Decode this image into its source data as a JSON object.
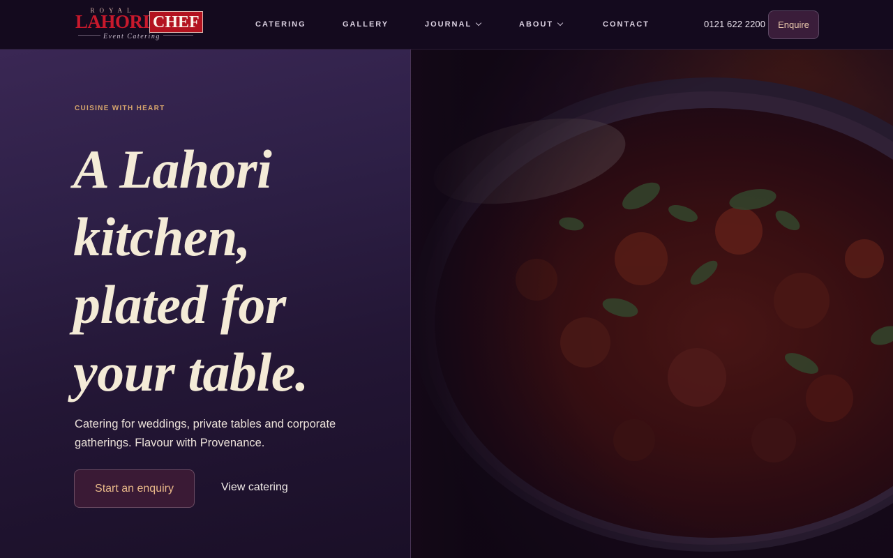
{
  "logo": {
    "royal": "ROYAL",
    "lahori": "LAHORI",
    "chef": "CHEF",
    "tagline": "Event Catering"
  },
  "nav": {
    "items": [
      {
        "label": "CATERING",
        "dropdown": false
      },
      {
        "label": "GALLERY",
        "dropdown": false
      },
      {
        "label": "JOURNAL",
        "dropdown": true
      },
      {
        "label": "ABOUT",
        "dropdown": true
      },
      {
        "label": "CONTACT",
        "dropdown": false
      }
    ]
  },
  "header": {
    "phone": "0121 622 2200",
    "enquire_label": "Enquire"
  },
  "hero": {
    "eyebrow": "CUISINE WITH HEART",
    "headline_lines": [
      "A Lahori",
      "kitchen,",
      "plated for",
      "your table."
    ],
    "subtext": "Catering for weddings, private tables and corporate gatherings. Flavour with Provenance.",
    "primary_cta": "Start an enquiry",
    "secondary_cta": "View catering"
  },
  "colors": {
    "header_bg": "#140a1e",
    "hero_left_bg": "#2e2047",
    "accent_gold": "#d7a66d",
    "button_bg": "#3a1a35",
    "logo_red": "#c8192c"
  }
}
